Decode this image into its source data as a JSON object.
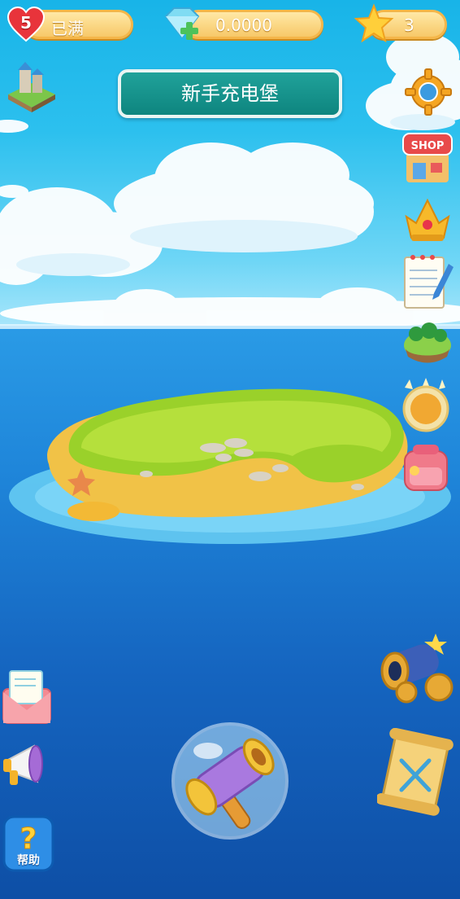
{
  "status_bar": {
    "lives": "5",
    "lives_status": "已满",
    "gems": "0.0000",
    "stars": "3"
  },
  "title": "新手充电堡",
  "icons": {
    "left_top": "island-castle-icon",
    "right": [
      "settings-gear-icon",
      "shop-icon",
      "crown-rank-icon",
      "task-notebook-icon",
      "world-map-island-icon",
      "achievement-medal-icon",
      "backpack-icon"
    ],
    "left_bottom": [
      "mail-icon",
      "announcement-megaphone-icon",
      "help-question-icon"
    ],
    "right_bottom": [
      "cannon-icon",
      "treasure-map-icon"
    ],
    "center_bottom": "hammer-bubble-icon"
  },
  "shop_sign": "SHOP",
  "help_label": "帮助",
  "colors": {
    "pill": "#f7c869",
    "title_bg": "#0e857f",
    "sky": "#2cc0ee",
    "sea": "#1565c0"
  }
}
